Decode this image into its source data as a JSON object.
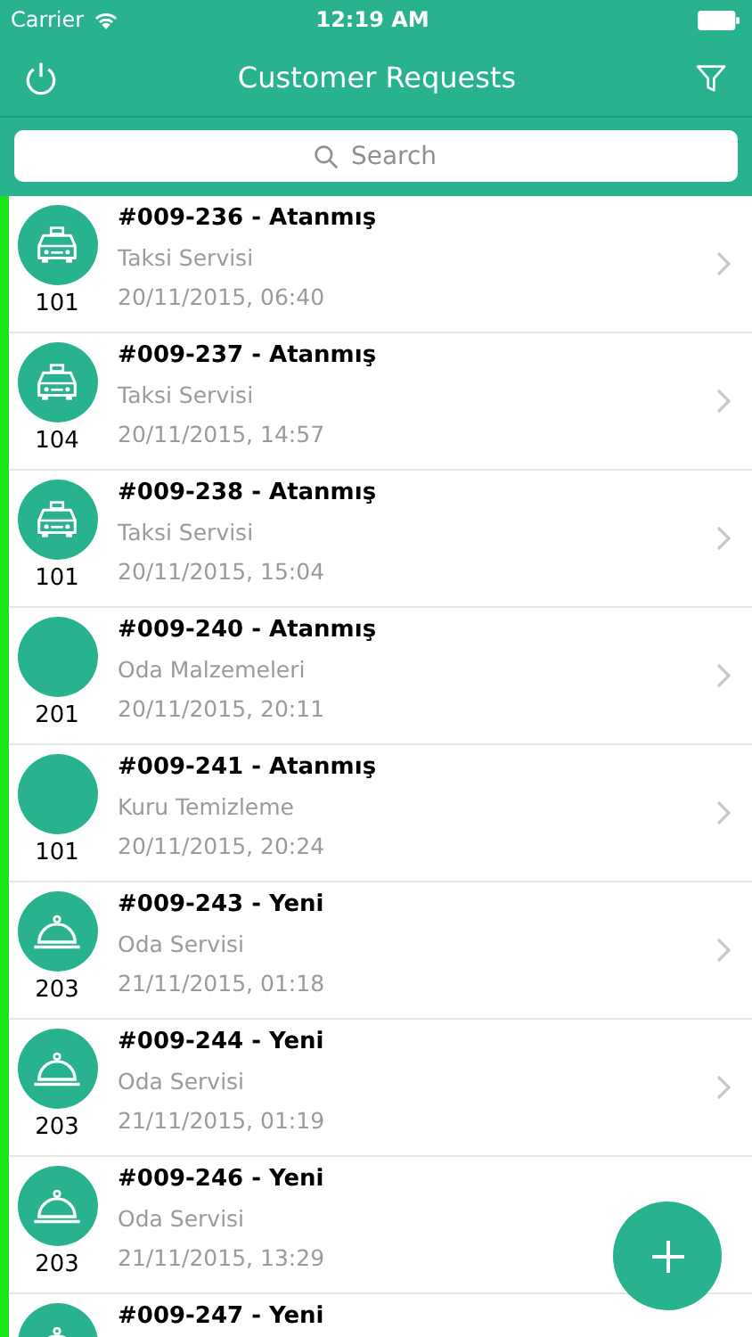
{
  "status_bar": {
    "carrier": "Carrier",
    "time": "12:19 AM"
  },
  "nav": {
    "title": "Customer Requests"
  },
  "search": {
    "placeholder": "Search"
  },
  "requests": [
    {
      "kind": "taxi",
      "room": "101",
      "title": "#009-236 - Atanmış",
      "service": "Taksi Servisi",
      "date": "20/11/2015, 06:40",
      "chevron": true
    },
    {
      "kind": "taxi",
      "room": "104",
      "title": "#009-237 - Atanmış",
      "service": "Taksi Servisi",
      "date": "20/11/2015, 14:57",
      "chevron": true
    },
    {
      "kind": "taxi",
      "room": "101",
      "title": "#009-238 - Atanmış",
      "service": "Taksi Servisi",
      "date": "20/11/2015, 15:04",
      "chevron": true
    },
    {
      "kind": "plain",
      "room": "201",
      "title": "#009-240 - Atanmış",
      "service": "Oda Malzemeleri",
      "date": "20/11/2015, 20:11",
      "chevron": true
    },
    {
      "kind": "plain",
      "room": "101",
      "title": "#009-241 - Atanmış",
      "service": "Kuru Temizleme",
      "date": "20/11/2015, 20:24",
      "chevron": true
    },
    {
      "kind": "cloche",
      "room": "203",
      "title": "#009-243 - Yeni",
      "service": "Oda Servisi",
      "date": "21/11/2015, 01:18",
      "chevron": true
    },
    {
      "kind": "cloche",
      "room": "203",
      "title": "#009-244 - Yeni",
      "service": "Oda Servisi",
      "date": "21/11/2015, 01:19",
      "chevron": true
    },
    {
      "kind": "cloche",
      "room": "203",
      "title": "#009-246 - Yeni",
      "service": "Oda Servisi",
      "date": "21/11/2015, 13:29",
      "chevron": false
    },
    {
      "kind": "cloche",
      "title": "#009-247 - Yeni",
      "chevron": false
    }
  ]
}
